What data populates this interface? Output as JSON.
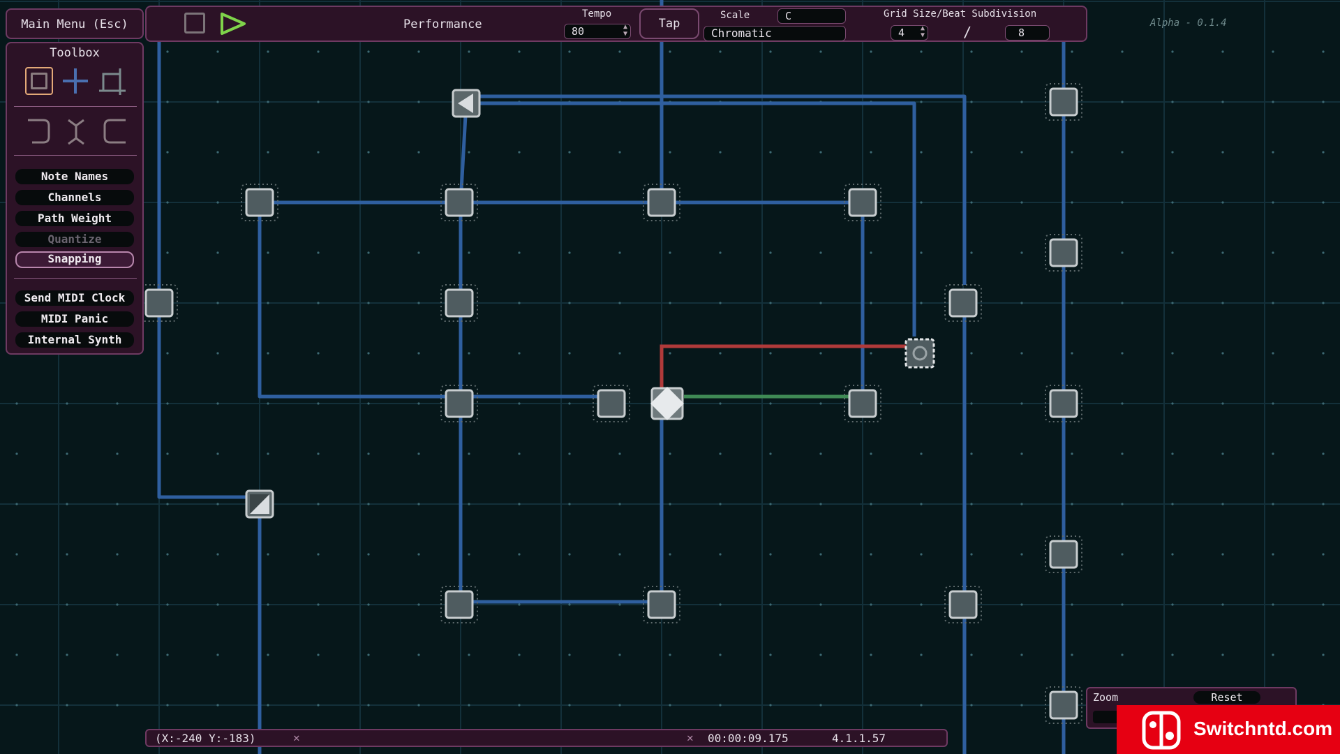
{
  "topbar": {
    "main_menu_label": "Main Menu (Esc)",
    "performance_label": "Performance",
    "tempo_label": "Tempo",
    "tempo_value": "80",
    "tap_label": "Tap",
    "scale_label": "Scale",
    "scale_key": "C",
    "scale_mode": "Chromatic",
    "grid_label": "Grid Size/Beat Subdivision",
    "grid_size": "4",
    "grid_divider": "/",
    "subdivision": "8",
    "version": "Alpha - 0.1.4"
  },
  "toolbox": {
    "title": "Toolbox",
    "options": [
      {
        "label": "Note Names",
        "state": "normal"
      },
      {
        "label": "Channels",
        "state": "normal"
      },
      {
        "label": "Path Weight",
        "state": "normal"
      },
      {
        "label": "Quantize",
        "state": "disabled"
      },
      {
        "label": "Snapping",
        "state": "selected"
      }
    ],
    "actions": [
      "Send MIDI Clock",
      "MIDI Panic",
      "Internal Synth"
    ]
  },
  "statusbar": {
    "coords": "(X:-240 Y:-183)",
    "time": "00:00:09.175",
    "position": "4.1.1.57"
  },
  "zoom": {
    "label": "Zoom",
    "reset_label": "Reset"
  },
  "watermark": "Switchntd.com",
  "colors": {
    "background": "#06171a",
    "panel": "#2c1226",
    "panel_border": "#6e3a62",
    "path_blue": "#2f5f9f",
    "path_red": "#b03a3a",
    "path_green": "#3f8a55",
    "play_green": "#7fd34a",
    "node_fill": "#4f5c60"
  },
  "icons": {
    "stop": "square-icon",
    "play": "triangle-play-icon",
    "tool_node": "square-node-icon",
    "tool_add": "plus-crosshair-icon",
    "tool_select": "selection-square-icon",
    "rotate_left": "curve-left-icon",
    "flip": "vertical-flip-icon",
    "rotate_right": "curve-right-icon",
    "switch_logo": "joycon-logo-icon"
  }
}
